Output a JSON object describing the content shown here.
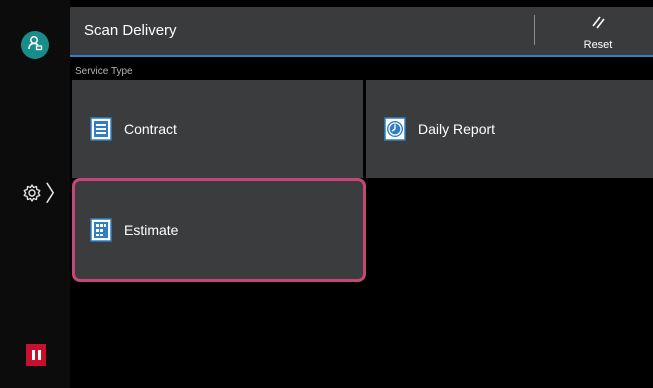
{
  "header": {
    "title": "Scan Delivery",
    "reset_label": "Reset",
    "accent_color": "#2e7fc4"
  },
  "service_type": {
    "label": "Service Type"
  },
  "tiles": [
    {
      "label": "Contract",
      "icon": "document-list-icon"
    },
    {
      "label": "Daily Report",
      "icon": "clock-icon"
    },
    {
      "label": "Estimate",
      "icon": "calculator-document-icon",
      "selected": true
    }
  ],
  "left_rail": {
    "user_icon": "user-icon",
    "settings_icon": "gear-icon",
    "pause_icon": "pause-icon"
  },
  "colors": {
    "selected_border": "#c54779",
    "user_badge": "#1a8c8a",
    "pause": "#c8102e"
  }
}
